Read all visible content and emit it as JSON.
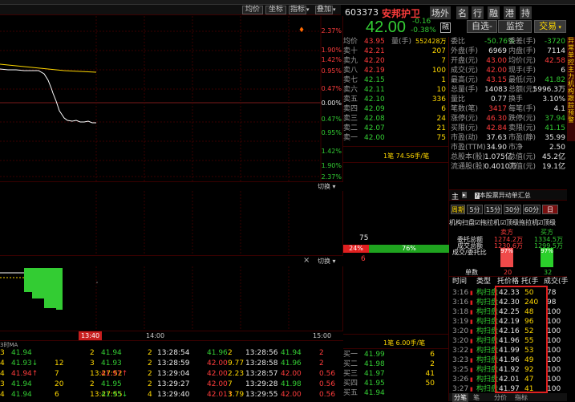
{
  "header": {
    "code": "603373",
    "name": "安邦护卫",
    "name_tabs": [
      "场外",
      "名",
      "行",
      "融",
      "港",
      "持"
    ],
    "price": "42.00",
    "change": "-0.16",
    "change_pct": "-0.38%",
    "stock_badge": "融",
    "btn_watch": "自选",
    "btn_monitor": "监控",
    "btn_trade": "交易",
    "chart_tools": [
      "叠加",
      "坐标",
      "指标",
      "均价"
    ],
    "top_partial": [
      "",
      "",
      "",
      ""
    ]
  },
  "left_chart": {
    "pct_labels": [
      "2.37%",
      "1.90%",
      "1.42%",
      "0.95%",
      "0.47%",
      "0.00%",
      "0.47%",
      "0.95%",
      "1.42%",
      "1.90%",
      "2.37%"
    ],
    "switch_label": "切换",
    "switch_label2": "切换",
    "close_icon": "×",
    "vol_axis_75": "75",
    "vol_axis_6": "6",
    "time_labels": [
      "13:40",
      "14:00",
      "15:00"
    ],
    "ma_label": "3时MA",
    "sell_bar_pct": "24%",
    "buy_bar_pct": "76%"
  },
  "orderbook": {
    "junjia_label": "均价",
    "junjia_val": "43.95",
    "liang_label": "量(手)",
    "liang_val": "552428万",
    "sells": [
      {
        "lbl": "卖十",
        "pr": "42.21",
        "vol": "207"
      },
      {
        "lbl": "卖九",
        "pr": "42.20",
        "vol": "7"
      },
      {
        "lbl": "卖八",
        "pr": "42.19",
        "vol": "100"
      },
      {
        "lbl": "卖七",
        "pr": "42.15",
        "vol": "1"
      },
      {
        "lbl": "卖六",
        "pr": "42.11",
        "vol": "10"
      },
      {
        "lbl": "卖五",
        "pr": "42.10",
        "vol": "336"
      },
      {
        "lbl": "卖四",
        "pr": "42.09",
        "vol": "6"
      },
      {
        "lbl": "卖三",
        "pr": "42.08",
        "vol": "24"
      },
      {
        "lbl": "卖二",
        "pr": "42.07",
        "vol": "21"
      },
      {
        "lbl": "卖一",
        "pr": "42.00",
        "vol": "75"
      }
    ],
    "mid_note1": "1笔 74.56手/笔",
    "mid_note2": "1笔 6.00手/笔",
    "buys": [
      {
        "lbl": "买一",
        "pr": "41.99",
        "vol": "6"
      },
      {
        "lbl": "买二",
        "pr": "41.98",
        "vol": "2"
      },
      {
        "lbl": "买三",
        "pr": "41.97",
        "vol": "41"
      },
      {
        "lbl": "买四",
        "pr": "41.95",
        "vol": "50"
      },
      {
        "lbl": "买五",
        "pr": "41.94",
        "vol": ""
      }
    ]
  },
  "quote": {
    "rows": [
      {
        "k1": "委比",
        "v1": "-50.76%",
        "k2": "委差(手)",
        "v2": "-3720"
      },
      {
        "k1": "外盘(手)",
        "v1": "6969",
        "k2": "内盘(手)",
        "v2": "7114"
      },
      {
        "k1": "开盘(元)",
        "v1": "43.00",
        "k2": "均价(元)",
        "v2": "42.58"
      },
      {
        "k1": "成交(元)",
        "v1": "42.00",
        "k2": "现手(手)",
        "v2": "6"
      },
      {
        "k1": "最高(元)",
        "v1": "43.15",
        "k2": "最低(元)",
        "v2": "41.82"
      },
      {
        "k1": "总量(手)",
        "v1": "14083",
        "k2": "总额(元)",
        "v2": "5996.3万"
      },
      {
        "k1": "量比",
        "v1": "0.77",
        "k2": "换手",
        "v2": "3.10%"
      },
      {
        "k1": "笔数(笔)",
        "v1": "3417",
        "k2": "每笔(手)",
        "v2": "4.1"
      },
      {
        "k1": "涨停(元)",
        "v1": "46.30",
        "k2": "跌停(元)",
        "v2": "37.94"
      },
      {
        "k1": "买限(元)",
        "v1": "42.84",
        "k2": "卖限(元)",
        "v2": "41.15"
      },
      {
        "k1": "市盈(动)",
        "v1": "37.63",
        "k2": "市盈(静)",
        "v2": "35.99"
      },
      {
        "k1": "市盈(TTM)",
        "v1": "34.90",
        "k2": "市净",
        "v2": "2.50"
      },
      {
        "k1": "总股本(股)",
        "v1": "1.075亿",
        "k2": "总值(元)",
        "v2": "45.2亿"
      },
      {
        "k1": "流通股(股)",
        "v1": "0.4010万",
        "k2": "流值(元)",
        "v2": "19.1亿"
      }
    ],
    "panel_tab_main": "主",
    "panel_tab_summary": "本股票异动单汇总",
    "period_tabs": [
      "周期",
      "5分",
      "15分",
      "30分",
      "60分",
      "日"
    ],
    "filter_tabs": [
      "机构扫盘",
      "拖拉机",
      "顶级拖拉机",
      "顶级"
    ],
    "buy_label": "买方",
    "sell_label": "卖方",
    "stats_labels": [
      "委托总额",
      "成交总额",
      "成交/委托比"
    ],
    "sell_stats": [
      "1274.2万",
      "1230.6万",
      "97%"
    ],
    "buy_stats": [
      "1334.5万",
      "1299.5万",
      "97%"
    ],
    "danshu_label": "单数",
    "sell_count": "20",
    "buy_count": "32",
    "trade_headers": [
      "时间",
      "类型",
      "托价格",
      "托(手",
      "成交(手"
    ],
    "trades": [
      {
        "t": "3:16",
        "type": "构扫盘",
        "p": "42.33",
        "h": "50",
        "c": "78"
      },
      {
        "t": "3:16",
        "type": "构扫盘",
        "p": "42.30",
        "h": "240",
        "c": "98"
      },
      {
        "t": "3:18",
        "type": "构扫盘",
        "p": "42.25",
        "h": "48",
        "c": "100"
      },
      {
        "t": "3:19",
        "type": "构扫盘",
        "p": "42.19",
        "h": "96",
        "c": "100"
      },
      {
        "t": "3:20",
        "type": "构扫盘",
        "p": "42.16",
        "h": "52",
        "c": "100"
      },
      {
        "t": "3:20",
        "type": "构扫盘",
        "p": "41.96",
        "h": "55",
        "c": "100"
      },
      {
        "t": "3:22",
        "type": "构扫盘",
        "p": "41.99",
        "h": "53",
        "c": "100"
      },
      {
        "t": "3:23",
        "type": "构扫盘",
        "p": "41.96",
        "h": "49",
        "c": "100"
      },
      {
        "t": "3:25",
        "type": "构扫盘",
        "p": "41.92",
        "h": "92",
        "c": "100"
      },
      {
        "t": "3:26",
        "type": "构扫盘",
        "p": "42.01",
        "h": "47",
        "c": "100"
      },
      {
        "t": "3:27",
        "type": "构扫盘",
        "p": "41.97",
        "h": "41",
        "c": "100"
      }
    ],
    "bottom_tabs": [
      "分笔",
      "笔",
      "分价",
      "指标"
    ]
  },
  "side_strip": {
    "text": "异常单控主力机构跟踪预警"
  },
  "ticks": [
    [
      "3",
      "41.94",
      "",
      "2",
      "41.94",
      "2",
      "13:28:54",
      "41.96",
      "2",
      "13:28:56",
      "41.94",
      "2"
    ],
    [
      "4",
      "41.93↓",
      "12",
      "3",
      "41.93",
      "2",
      "13:28:59",
      "42.00",
      "9.77",
      "13:28:58",
      "41.96",
      "2"
    ],
    [
      "4",
      "41.94↑",
      "7",
      "13:27:52",
      "41.97↑",
      "2",
      "13:29:04",
      "42.00",
      "2.23",
      "13:28:57",
      "42.00",
      "0.56"
    ],
    [
      "3",
      "41.94",
      "20",
      "2",
      "41.95",
      "2",
      "13:29:27",
      "42.00",
      "7",
      "13:29:28",
      "41.98",
      "0.56"
    ],
    [
      "4",
      "41.94",
      "6",
      "13:27:55",
      "41.95↓",
      "4",
      "13:29:40",
      "42.01↑",
      "3.79",
      "13:29:55",
      "42.00",
      "0.56"
    ]
  ],
  "colors": {
    "up": "#ff3c3c",
    "down": "#33cc33",
    "accent": "#ffd800",
    "price": "#5fd7ff"
  }
}
